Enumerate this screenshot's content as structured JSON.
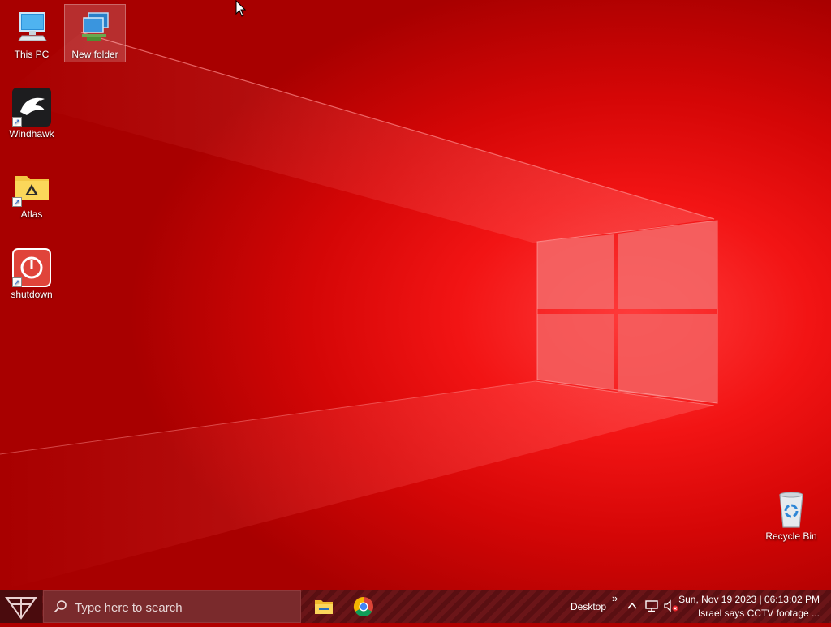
{
  "desktop": {
    "icons": [
      {
        "label": "This PC",
        "icon": "this-pc-icon"
      },
      {
        "label": "New folder",
        "icon": "network-folder-icon"
      },
      {
        "label": "Windhawk",
        "icon": "windhawk-eagle-icon"
      },
      {
        "label": "Atlas",
        "icon": "atlas-folder-icon"
      },
      {
        "label": "shutdown",
        "icon": "power-icon"
      },
      {
        "label": "Recycle Bin",
        "icon": "recycle-bin-icon"
      }
    ]
  },
  "taskbar": {
    "search_placeholder": "Type here to search",
    "desktop_label": "Desktop",
    "overflow_glyph": "»",
    "clock_line1": "Sun, Nov 19 2023 | 06:13:02 PM",
    "clock_line2": "Israel says CCTV footage ...",
    "pinned": [
      {
        "name": "File Explorer",
        "icon": "file-explorer-icon"
      },
      {
        "name": "Google Chrome",
        "icon": "chrome-icon"
      }
    ]
  },
  "colors": {
    "wallpaper": "#e00a0a",
    "taskbar": "#5a0f12",
    "search": "#7a2a2c"
  }
}
